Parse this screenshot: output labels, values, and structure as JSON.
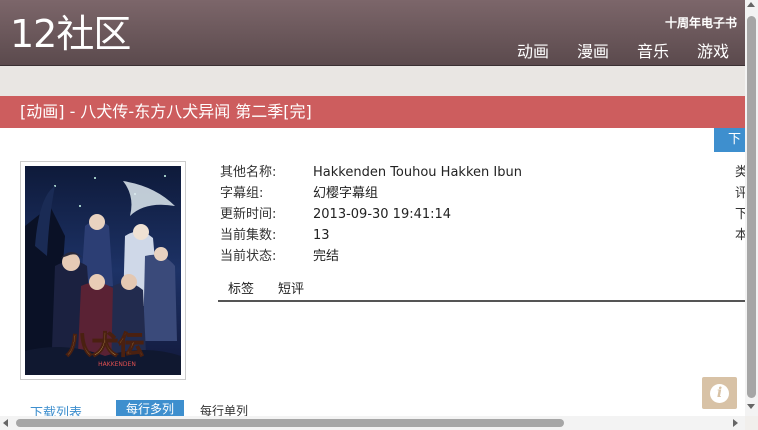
{
  "header": {
    "logo": "12社区",
    "top_link": "十周年电子书",
    "nav": [
      "动画",
      "漫画",
      "音乐",
      "游戏"
    ]
  },
  "title_bar": {
    "title": "[动画] - 八犬传-东方八犬异闻 第二季[完]"
  },
  "download_button": "下",
  "poster": {
    "alt": "八犬伝",
    "subtitle": "HAKKENDEN"
  },
  "info": {
    "rows": [
      {
        "label": "其他名称:",
        "value": "Hakkenden Touhou Hakken Ibun",
        "right": "类"
      },
      {
        "label": "字幕组:",
        "value": "幻樱字幕组",
        "right": "评"
      },
      {
        "label": "更新时间:",
        "value": "2013-09-30 19:41:14",
        "right": "下"
      },
      {
        "label": "当前集数:",
        "value": "13",
        "right": "本"
      },
      {
        "label": "当前状态:",
        "value": "完结",
        "right": ""
      }
    ]
  },
  "tabs": [
    "标签",
    "短评"
  ],
  "bottom_links": {
    "download_list": "下载列表",
    "multi": "每行多列",
    "single": "每行单列"
  },
  "info_button": "i",
  "colors": {
    "header": "#6b5659",
    "title_bar": "#cd5d5e",
    "accent": "#3e8fce",
    "info_button": "#d8c2a6"
  }
}
